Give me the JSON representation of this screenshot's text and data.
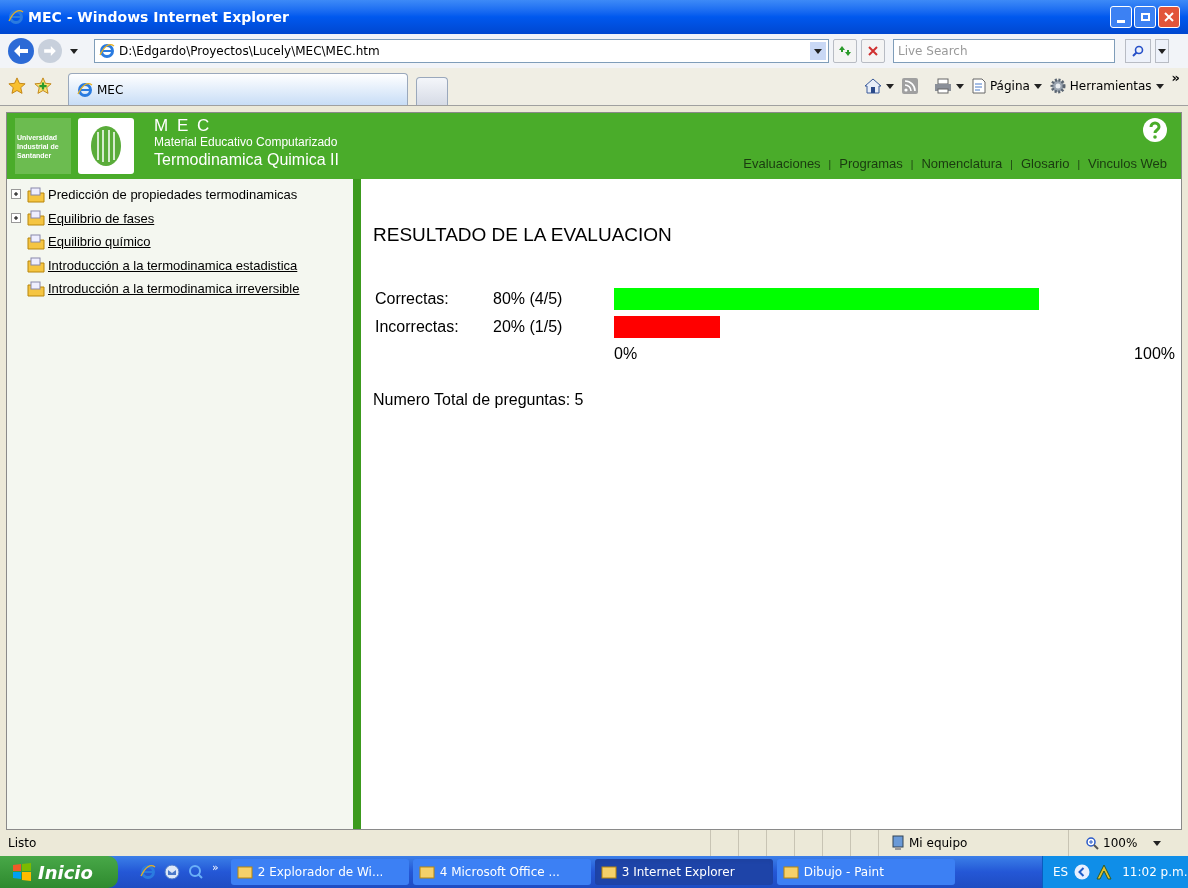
{
  "window": {
    "title": "MEC - Windows Internet Explorer"
  },
  "address_bar": {
    "value": "D:\\Edgardo\\Proyectos\\Lucely\\MEC\\MEC.htm"
  },
  "search": {
    "placeholder": "Live Search"
  },
  "tabs": [
    {
      "label": "MEC",
      "selected": true
    }
  ],
  "command_bar": {
    "page": "Página",
    "tools": "Herramientas",
    "more": "»"
  },
  "header": {
    "university": "Universidad Industrial de Santander",
    "title": "M E C",
    "subtitle": "Material Educativo Computarizado",
    "course": "Termodinamica Quimica II",
    "nav": [
      {
        "label": "Evaluaciones",
        "separator": "|"
      },
      {
        "label": "Programas",
        "separator": "|"
      },
      {
        "label": "Nomenclatura",
        "separator": "|"
      },
      {
        "label": "Glosario",
        "separator": "|"
      },
      {
        "label": "Vinculos Web"
      }
    ]
  },
  "tree": [
    {
      "label": "Predicción de propiedades termodinamicas",
      "expandable": true,
      "expanded": false,
      "underlined": false
    },
    {
      "label": "Equilibrio de fases",
      "expandable": true,
      "expanded": false,
      "underlined": true
    },
    {
      "label": "Equilibrio químico",
      "expandable": false,
      "underlined": true
    },
    {
      "label": "Introducción a la termodinamica estadistica",
      "expandable": false,
      "underlined": true
    },
    {
      "label": "Introducción a la termodinamica irreversible",
      "expandable": false,
      "underlined": true
    }
  ],
  "result": {
    "title": "RESULTADO DE LA EVALUACION",
    "rows": [
      {
        "label": "Correctas:",
        "value": "80% (4/5)",
        "level": 0.8,
        "color": "#00ff00"
      },
      {
        "label": "Incorrectas:",
        "value": "20% (1/5)",
        "level": 0.2,
        "color": "#ff0000"
      }
    ],
    "scale_min": "0%",
    "scale_max": "100%",
    "total": "Numero Total de preguntas: 5"
  },
  "status_bar": {
    "text": "Listo",
    "zone": "Mi equipo",
    "zoom": "100%"
  },
  "taskbar": {
    "start": "Inicio",
    "quick_more": "»",
    "items": [
      {
        "label": "2 Explorador de Wi...",
        "selected": false
      },
      {
        "label": "4 Microsoft Office ...",
        "selected": false
      },
      {
        "label": "3 Internet Explorer",
        "selected": true
      },
      {
        "label": "Dibujo - Paint",
        "selected": false
      }
    ],
    "language": "ES",
    "clock": "11:02 p.m."
  }
}
